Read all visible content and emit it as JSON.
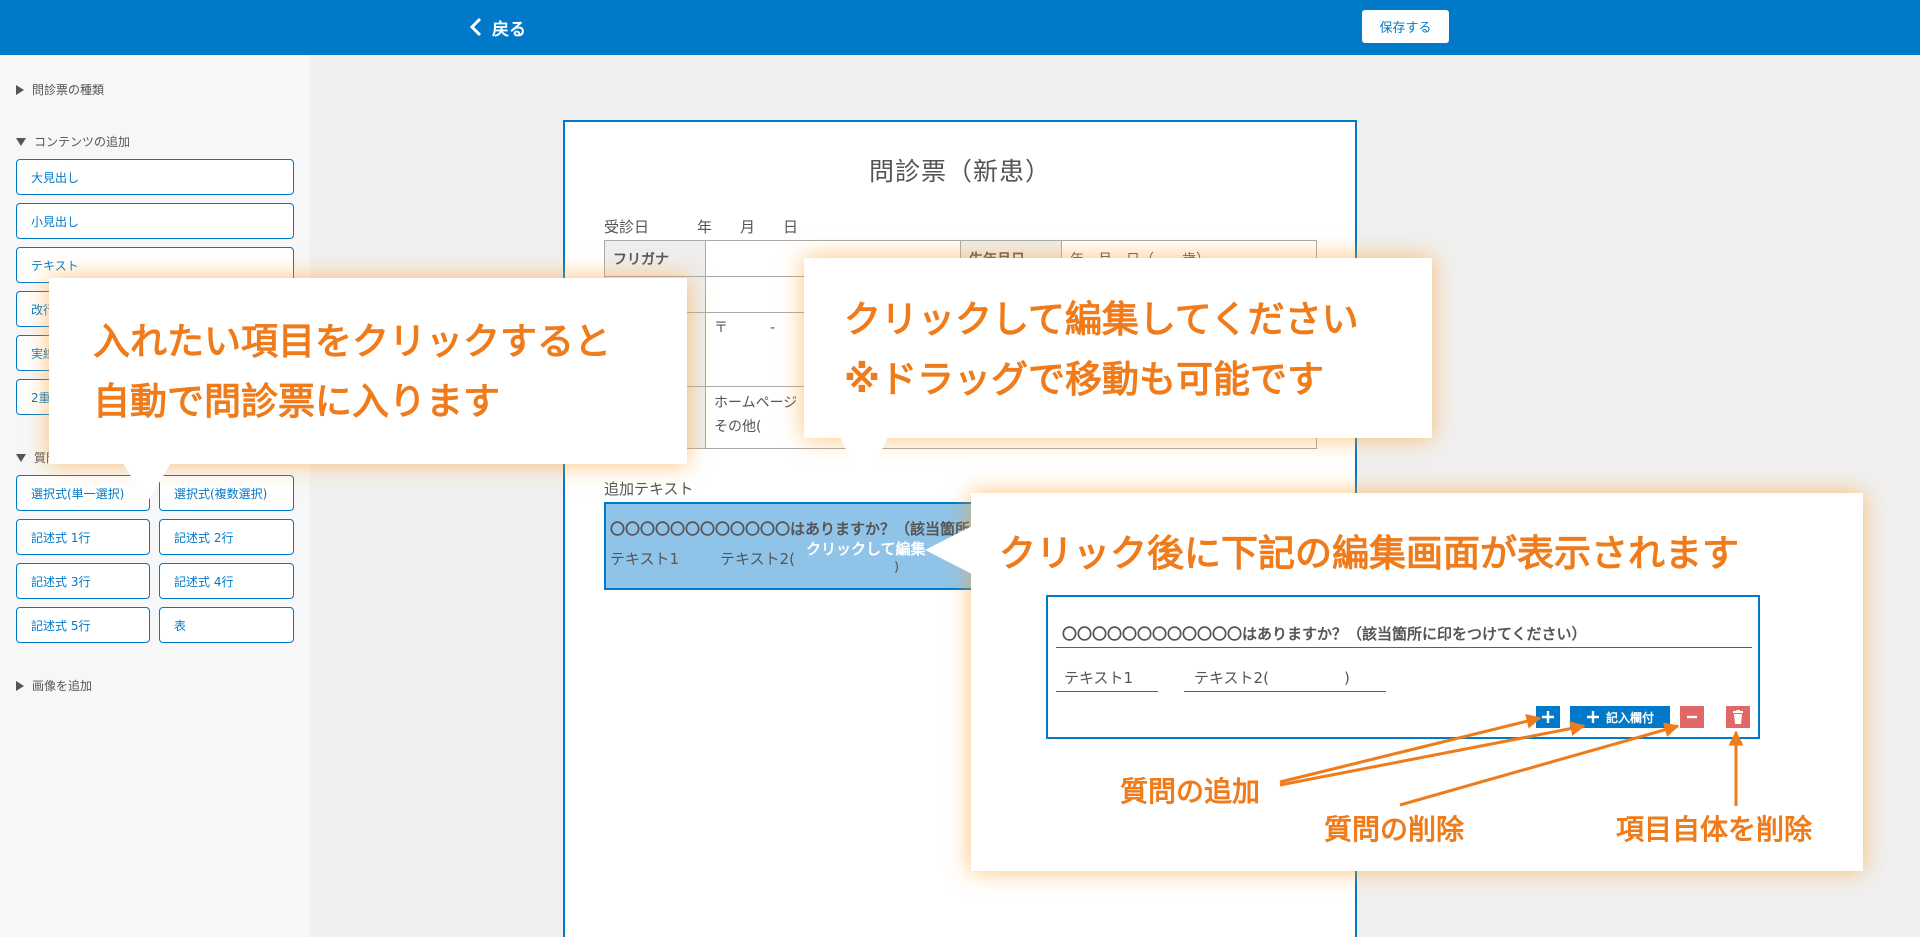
{
  "header": {
    "back_label": "戻る",
    "save_label": "保存する",
    "bg_color": "#0079c9"
  },
  "sidebar": {
    "section_types": "問診票の種類",
    "section_contents": "コンテンツの追加",
    "content_buttons": [
      "大見出し",
      "小見出し",
      "テキスト",
      "改行",
      "実線",
      "2重線"
    ],
    "section_questions": "質問の追加",
    "question_buttons": [
      "選択式(単一選択)",
      "選択式(複数選択)",
      "記述式 1行",
      "記述式 2行",
      "記述式 3行",
      "記述式 4行",
      "記述式 5行",
      "表"
    ],
    "section_images": "画像を追加"
  },
  "document": {
    "title": "問診票（新患）",
    "reception_label": "受診日",
    "year": "年",
    "month": "月",
    "day": "日",
    "furigana": "フリガナ",
    "birthday": "生年月日",
    "birthday_value": "年　月　日（　　歳）",
    "postal": "〒　　　-",
    "homepage": "ホームページ",
    "other": "その他(",
    "added_text_label": "追加テキスト",
    "question_text": "〇〇〇〇〇〇〇〇〇〇〇〇はありますか？（該当箇所に印をつけてください）",
    "option1": "テキスト1",
    "option2": "テキスト2(",
    "close_paren": ")",
    "ghost_text": "クリックして編集"
  },
  "callouts": {
    "left_line1": "入れたい項目をクリックすると",
    "left_line2": "自動で問診票に入ります",
    "mid_line1": "クリックして編集してください",
    "mid_line2": "※ドラッグで移動も可能です",
    "right_title": "クリック後に下記の編集画面が表示されます"
  },
  "preview": {
    "question": "〇〇〇〇〇〇〇〇〇〇〇〇はありますか？（該当箇所に印をつけてください）",
    "option1": "テキスト1",
    "option2": "テキスト2(　　　　　)",
    "add_field_label": "記入欄付"
  },
  "annotations": {
    "add_question": "質問の追加",
    "delete_question": "質問の削除",
    "delete_item": "項目自体を削除"
  },
  "colors": {
    "accent": "#0079c9",
    "callout_text": "#ef7b1a",
    "danger": "#e06868"
  }
}
